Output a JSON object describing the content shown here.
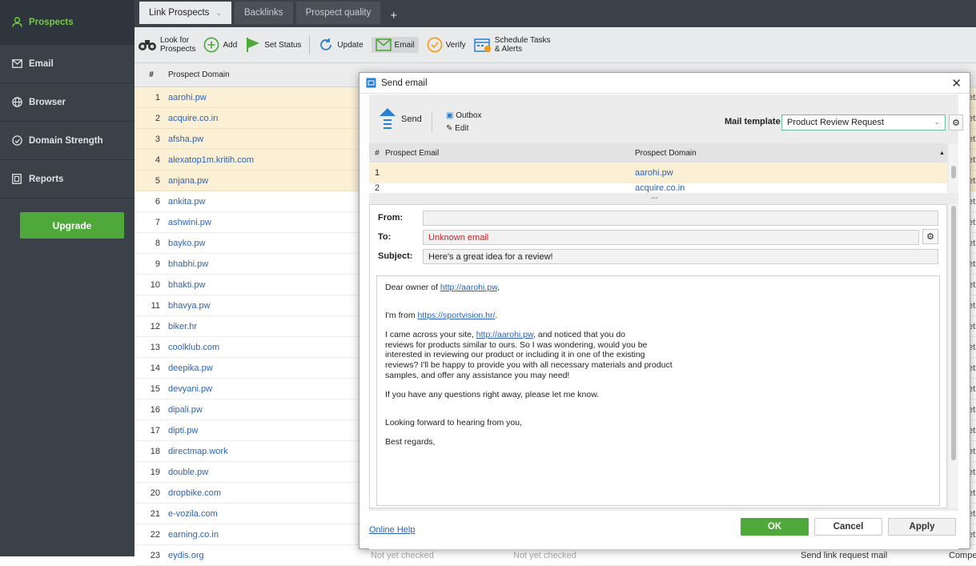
{
  "sidebar": {
    "items": [
      {
        "label": "Prospects",
        "icon": "user-icon",
        "active": true
      },
      {
        "label": "Email",
        "icon": "envelope-icon"
      },
      {
        "label": "Browser",
        "icon": "globe-icon"
      },
      {
        "label": "Domain Strength",
        "icon": "gauge-icon"
      },
      {
        "label": "Reports",
        "icon": "report-icon"
      }
    ],
    "upgrade_label": "Upgrade"
  },
  "tabs": [
    {
      "label": "Link Prospects",
      "active": true
    },
    {
      "label": "Backlinks"
    },
    {
      "label": "Prospect quality"
    }
  ],
  "toolbar": {
    "look_for_line1": "Look for",
    "look_for_line2": "Prospects",
    "add": "Add",
    "set_status": "Set Status",
    "update": "Update",
    "email": "Email",
    "verify": "Verify",
    "schedule_line1": "Schedule Tasks",
    "schedule_line2": "& Alerts"
  },
  "grid": {
    "headers": {
      "num": "#",
      "domain": "Prospect Domain"
    },
    "rows": [
      {
        "n": "1",
        "d": "aarohi.pw"
      },
      {
        "n": "2",
        "d": "acquire.co.in"
      },
      {
        "n": "3",
        "d": "afsha.pw"
      },
      {
        "n": "4",
        "d": "alexatop1m.kritih.com"
      },
      {
        "n": "5",
        "d": "anjana.pw"
      },
      {
        "n": "6",
        "d": "ankita.pw"
      },
      {
        "n": "7",
        "d": "ashwini.pw"
      },
      {
        "n": "8",
        "d": "bayko.pw"
      },
      {
        "n": "9",
        "d": "bhabhi.pw"
      },
      {
        "n": "10",
        "d": "bhakti.pw"
      },
      {
        "n": "11",
        "d": "bhavya.pw"
      },
      {
        "n": "12",
        "d": "biker.hr"
      },
      {
        "n": "13",
        "d": "coolklub.com"
      },
      {
        "n": "14",
        "d": "deepika.pw"
      },
      {
        "n": "15",
        "d": "devyani.pw"
      },
      {
        "n": "16",
        "d": "dipali.pw"
      },
      {
        "n": "17",
        "d": "dipti.pw"
      },
      {
        "n": "18",
        "d": "directmap.work"
      },
      {
        "n": "19",
        "d": "double.pw"
      },
      {
        "n": "20",
        "d": "dropbike.com"
      },
      {
        "n": "21",
        "d": "e-vozila.com"
      },
      {
        "n": "22",
        "d": "earning.co.in"
      },
      {
        "n": "23",
        "d": "eydis.org"
      }
    ],
    "right_col_fragment": "eti",
    "last_row_extra": {
      "c1": "Not yet checked",
      "c2": "Not yet checked",
      "c3": "Send link request mail",
      "c4": "Competi"
    }
  },
  "dialog": {
    "title": "Send email",
    "send": "Send",
    "outbox": "Outbox",
    "edit": "Edit",
    "mail_template_label": "Mail template",
    "mail_template_value": "Product Review Request",
    "table_headers": {
      "num": "#",
      "email": "Prospect Email",
      "domain": "Prospect Domain"
    },
    "table_rows": [
      {
        "n": "1",
        "email": "",
        "domain": "aarohi.pw"
      },
      {
        "n": "2",
        "email": "",
        "domain": "acquire.co.in"
      }
    ],
    "from_label": "From:",
    "from_value": "",
    "to_label": "To:",
    "to_value": "Unknown email",
    "subject_label": "Subject:",
    "subject_value": "Here's a great idea for a review!",
    "body": {
      "greeting_prefix": "Dear owner of ",
      "greeting_link": "http://aarohi.pw",
      "greeting_suffix": ",",
      "from_prefix": "I'm  from ",
      "from_link": "https://sportvision.hr/",
      "from_suffix": ".",
      "para1_prefix": "I came across your site, ",
      "para1_link": "http://aarohi.pw",
      "para1_line1_suffix": ", and noticed that you do",
      "para1_line2": "reviews for products similar to ours. So I was wondering, would you be",
      "para1_line3": "interested in reviewing our product or including it in one of the existing",
      "para1_line4": "reviews? I'll be happy to provide you with all necessary materials and product",
      "para1_line5": "samples, and offer any assistance you may need!",
      "para2": "If you have any questions right away, please let me know.",
      "closing1": "Looking forward to hearing from you,",
      "closing2": "Best regards,"
    },
    "online_help": "Online Help",
    "ok": "OK",
    "cancel": "Cancel",
    "apply": "Apply"
  }
}
